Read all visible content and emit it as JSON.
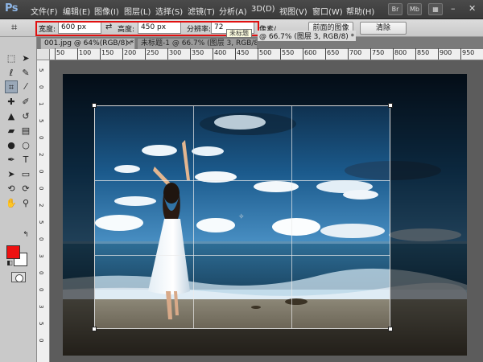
{
  "app": {
    "logo": "Ps"
  },
  "menu": {
    "items": [
      "文件(F)",
      "编辑(E)",
      "图像(I)",
      "图层(L)",
      "选择(S)",
      "滤镜(T)",
      "分析(A)",
      "3D(D)",
      "视图(V)",
      "窗口(W)",
      "帮助(H)"
    ],
    "right_buttons": [
      "Br",
      "Mb"
    ]
  },
  "options": {
    "width_label": "宽度:",
    "width_value": "600 px",
    "height_label": "高度:",
    "height_value": "450 px",
    "resolution_label": "分辨率:",
    "resolution_value": "72",
    "units_label": "像素/",
    "front_image_button": "前面的图像",
    "clear_button": "清除",
    "tooltip": "未标题"
  },
  "tabs": [
    {
      "label": "001.jpg @ 64%(RGB/8) *"
    },
    {
      "label": "未标题-1 @ 66.7% (图层 3, RGB/8) *"
    }
  ],
  "status_fragment": "@ 66.7% (图层 3, RGB/8) *",
  "ruler": {
    "top_labels": [
      "50",
      "100",
      "150",
      "200",
      "250",
      "300",
      "350",
      "400",
      "450",
      "500",
      "550",
      "600",
      "650",
      "700",
      "750",
      "800",
      "850",
      "900",
      "950"
    ],
    "left_labels": [
      "5",
      "0",
      "1",
      "5",
      "0",
      "2",
      "0",
      "0",
      "2",
      "5",
      "0",
      "3",
      "0",
      "0",
      "3",
      "5",
      "0"
    ]
  },
  "colors": {
    "foreground": "#ee1111",
    "background": "#ffffff",
    "highlight": "#e01010"
  },
  "tools": [
    "move-icon",
    "marquee-icon",
    "lasso-icon",
    "quick-select-icon",
    "crop-icon",
    "eyedropper-icon",
    "healing-brush-icon",
    "brush-icon",
    "clone-stamp-icon",
    "history-brush-icon",
    "eraser-icon",
    "gradient-icon",
    "blur-icon",
    "dodge-icon",
    "pen-icon",
    "type-icon",
    "path-select-icon",
    "shape-icon",
    "3d-rotate-icon",
    "3d-orbit-icon",
    "hand-icon",
    "zoom-icon"
  ]
}
